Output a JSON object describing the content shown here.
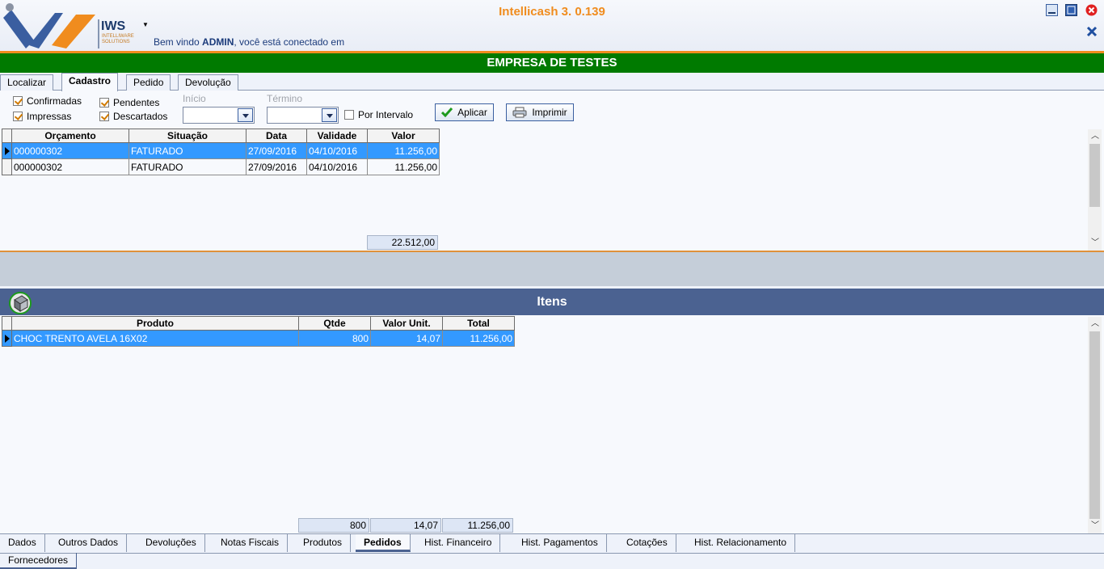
{
  "header": {
    "app_title": "Intellicash 3. 0.139",
    "logo_text": "IWS",
    "logo_subtext": "INTELLIWARE SOLUTIONS",
    "welcome_prefix": "Bem vindo ",
    "user": "ADMIN",
    "welcome_suffix": ", você está conectado em",
    "accent_color": "#f08c1e"
  },
  "company": {
    "name": "EMPRESA DE TESTES",
    "bar_color": "#007a00"
  },
  "top_tabs": [
    {
      "label": "Localizar"
    },
    {
      "label": "Cadastro",
      "active": true
    },
    {
      "label": "Pedido"
    },
    {
      "label": "Devolução"
    }
  ],
  "filters": {
    "confirmadas": {
      "label": "Confirmadas",
      "checked": true
    },
    "pendentes": {
      "label": "Pendentes",
      "checked": true
    },
    "impressas": {
      "label": "Impressas",
      "checked": true
    },
    "descartados": {
      "label": "Descartados",
      "checked": true
    },
    "inicio_label": "Início",
    "termino_label": "Término",
    "por_intervalo": {
      "label": "Por Intervalo",
      "checked": false
    },
    "aplicar_label": "Aplicar",
    "imprimir_label": "Imprimir"
  },
  "orcamentos": {
    "columns": [
      "Orçamento",
      "Situação",
      "Data",
      "Validade",
      "Valor"
    ],
    "rows": [
      {
        "orcamento": "000000302",
        "situacao": "FATURADO",
        "data": "27/09/2016",
        "validade": "04/10/2016",
        "valor": "11.256,00",
        "selected": true
      },
      {
        "orcamento": "000000302",
        "situacao": "FATURADO",
        "data": "27/09/2016",
        "validade": "04/10/2016",
        "valor": "11.256,00",
        "selected": false
      }
    ],
    "total_valor": "22.512,00"
  },
  "itens": {
    "title": "Itens",
    "columns": [
      "Produto",
      "Qtde",
      "Valor Unit.",
      "Total"
    ],
    "rows": [
      {
        "produto": "CHOC TRENTO AVELA 16X02",
        "qtde": "800",
        "valor_unit": "14,07",
        "total": "11.256,00",
        "selected": true
      }
    ],
    "totals": {
      "qtde": "800",
      "valor_unit": "14,07",
      "total": "11.256,00"
    },
    "header_color": "#4b6291"
  },
  "bottom_tabs": [
    {
      "label": "Dados"
    },
    {
      "label": "Outros Dados"
    },
    {
      "label": "Devoluções"
    },
    {
      "label": "Notas Fiscais"
    },
    {
      "label": "Produtos"
    },
    {
      "label": "Pedidos",
      "active": true
    },
    {
      "label": "Hist. Financeiro"
    },
    {
      "label": "Hist. Pagamentos"
    },
    {
      "label": "Cotações"
    },
    {
      "label": "Hist. Relacionamento"
    }
  ],
  "footer_tab": {
    "label": "Fornecedores"
  },
  "icons": [
    "logo",
    "minimize-icon",
    "maximize-icon",
    "close-icon",
    "close-x-icon",
    "checkmark-icon",
    "printer-icon",
    "items-box-icon",
    "row-pointer-icon"
  ]
}
